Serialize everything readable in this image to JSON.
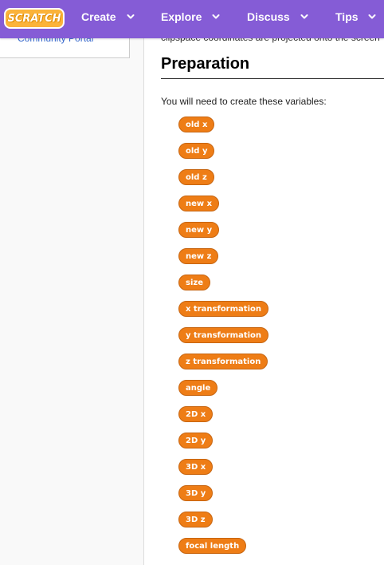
{
  "nav": {
    "logo_text": "SCRATCH",
    "items": [
      {
        "label": "Create"
      },
      {
        "label": "Explore"
      },
      {
        "label": "Discuss"
      },
      {
        "label": "Tips"
      }
    ]
  },
  "sidebar": {
    "link_label": "Community Portal"
  },
  "content": {
    "clip_text": "clipspace coordinates are projected onto the screen",
    "heading": "Preparation",
    "intro": "You will need to create these variables:",
    "variables": [
      "old x",
      "old y",
      "old z",
      "new x",
      "new y",
      "new z",
      "size",
      "x transformation",
      "y transformation",
      "z transformation",
      "angle",
      "2D x",
      "2D y",
      "3D x",
      "3D y",
      "3D z",
      "focal length"
    ]
  },
  "colors": {
    "nav_bg": "#855cd6",
    "variable_block": "#ee7d16",
    "link": "#3366cc"
  },
  "icons": [
    "chevron-down-icon",
    "scratch-logo"
  ]
}
